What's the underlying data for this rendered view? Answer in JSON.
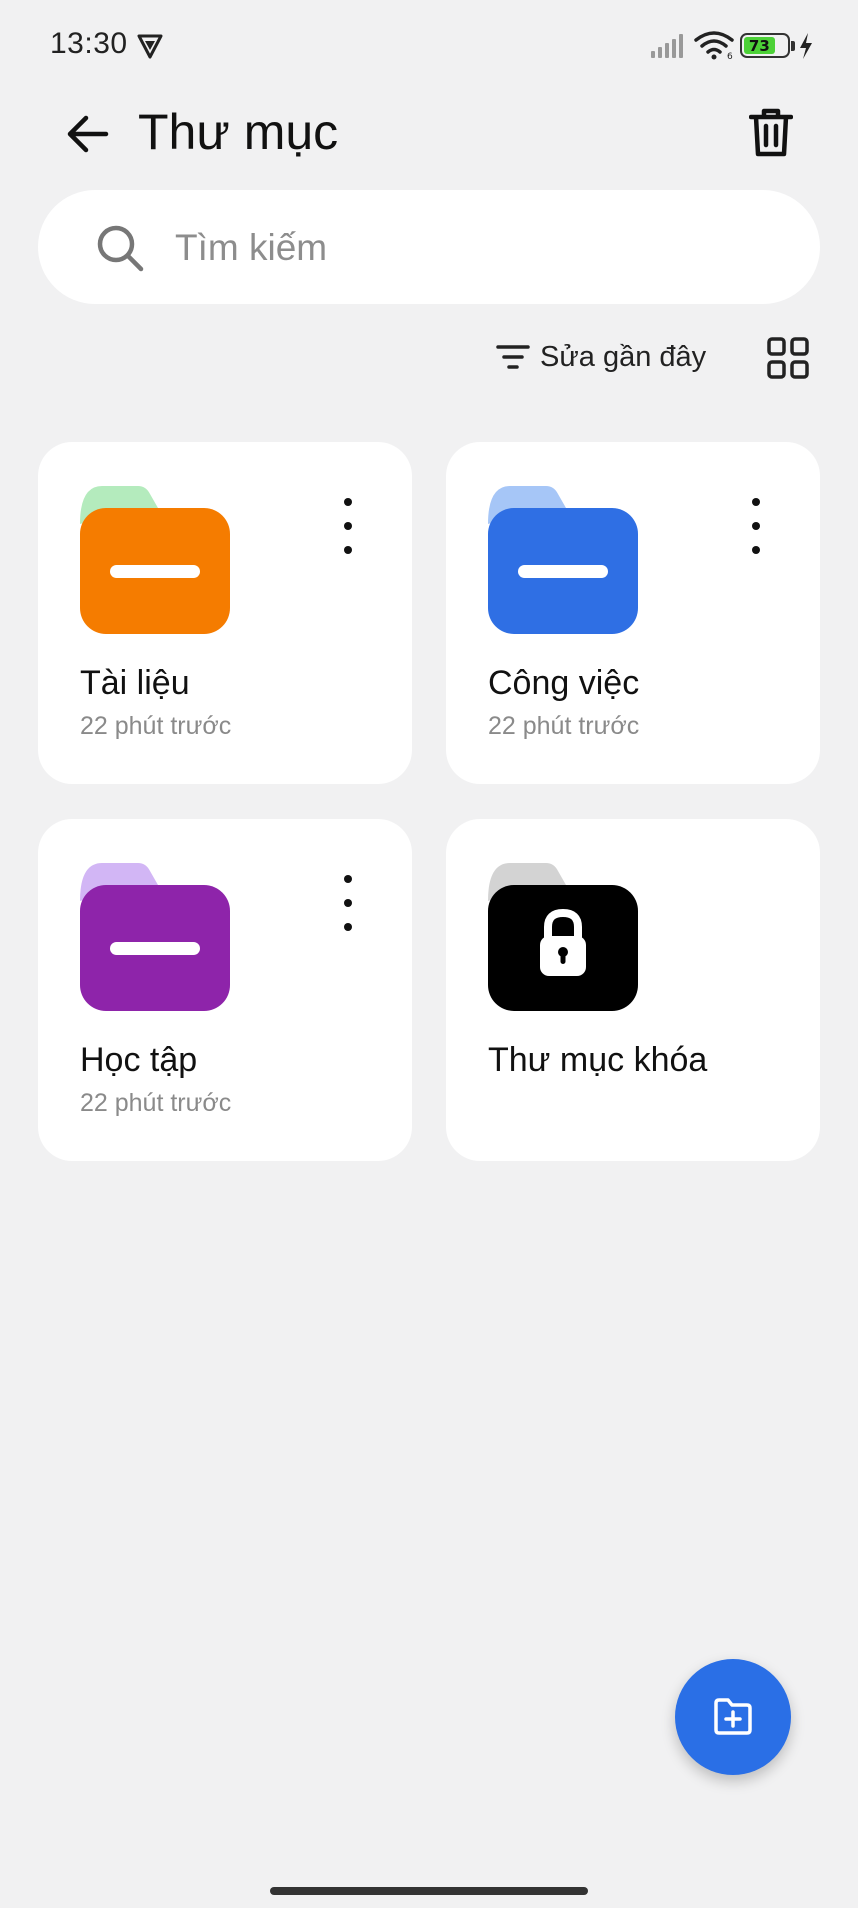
{
  "status_bar": {
    "time": "13:30",
    "battery_level": "73",
    "battery_color": "#4cd137"
  },
  "header": {
    "title": "Thư mục",
    "back_icon": "arrow-left-icon",
    "trash_icon": "trash-icon"
  },
  "search": {
    "placeholder": "Tìm kiếm",
    "value": ""
  },
  "toolbar": {
    "sort_label": "Sửa gần đây",
    "sort_icon": "filter-lines-icon",
    "view_icon": "grid-view-icon"
  },
  "folders": [
    {
      "name": "Tài liệu",
      "time": "22 phút trước",
      "color": "#f57c00",
      "tab_color": "#b4ebbd"
    },
    {
      "name": "Công việc",
      "time": "22 phút trước",
      "color": "#2f6fe4",
      "tab_color": "#a6c6f7"
    },
    {
      "name": "Học tập",
      "time": "22 phút trước",
      "color": "#8e24aa",
      "tab_color": "#d2b6f5"
    },
    {
      "name": "Thư mục khóa",
      "time": "",
      "color": "#000000",
      "tab_color": "#d3d3d3",
      "locked": true
    }
  ],
  "fab": {
    "icon": "add-folder-icon",
    "color": "#2a6fe6"
  }
}
